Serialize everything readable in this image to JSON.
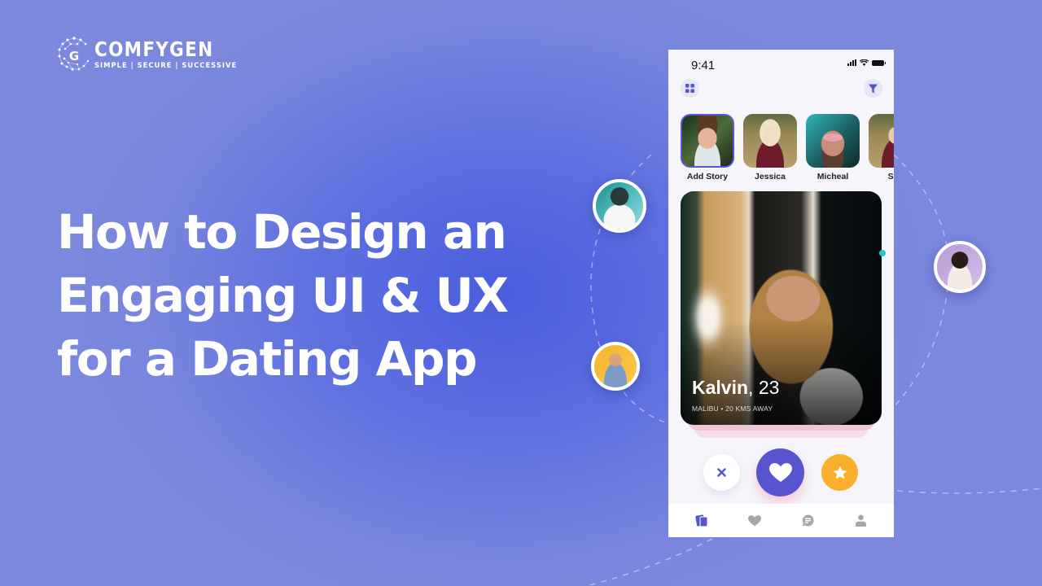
{
  "brand": {
    "name": "COMFYGEN",
    "tagline": "SIMPLE | SECURE | SUCCESSIVE"
  },
  "headline": {
    "lines": [
      "How to Design an",
      "Engaging UI & UX",
      "for a Dating App"
    ]
  },
  "colors": {
    "background": "#5d6fe0",
    "accent": "#5654cf",
    "star": "#fbb02d",
    "text_light": "#ffffff"
  },
  "phone": {
    "status_bar": {
      "time": "9:41",
      "icons": [
        "signal-icon",
        "wifi-icon",
        "battery-icon"
      ]
    },
    "header": {
      "left_icon": "grid-menu-icon",
      "right_icon": "filter-icon"
    },
    "stories": [
      {
        "name": "Add Story",
        "active": true
      },
      {
        "name": "Jessica",
        "active": false
      },
      {
        "name": "Micheal",
        "active": false
      },
      {
        "name": "Sca",
        "active": false
      }
    ],
    "profile_card": {
      "name": "Kalvin",
      "age": "23",
      "location": "MALIBU • 20 KMS AWAY"
    },
    "actions": [
      {
        "name": "reject",
        "icon": "close-icon"
      },
      {
        "name": "like",
        "icon": "heart-icon"
      },
      {
        "name": "super-like",
        "icon": "star-icon"
      }
    ],
    "tabs": [
      {
        "name": "cards",
        "icon": "cards-icon",
        "active": true
      },
      {
        "name": "likes",
        "icon": "heart-icon",
        "active": false
      },
      {
        "name": "messages",
        "icon": "chat-icon",
        "active": false
      },
      {
        "name": "profile",
        "icon": "user-icon",
        "active": false
      }
    ]
  }
}
